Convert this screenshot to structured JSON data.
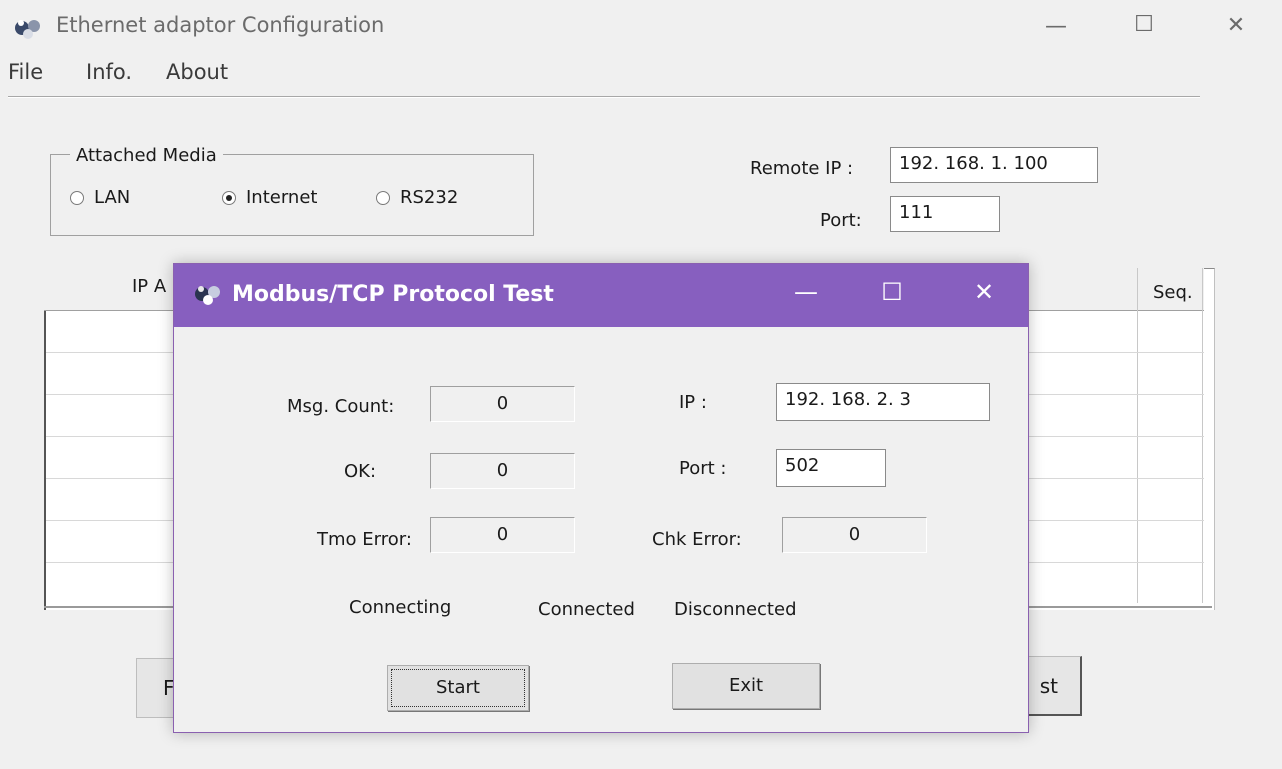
{
  "main_window": {
    "title": "Ethernet adaptor Configuration",
    "controls": {
      "minimize": "—",
      "maximize": "☐",
      "close": "✕"
    },
    "menu": [
      "File",
      "Info.",
      "About"
    ]
  },
  "attached_media": {
    "label": "Attached Media",
    "options": [
      {
        "label": "LAN",
        "selected": false
      },
      {
        "label": "Internet",
        "selected": true
      },
      {
        "label": "RS232",
        "selected": false
      }
    ]
  },
  "remote": {
    "ip_label": "Remote  IP :",
    "ip_value": "192. 168. 1. 100",
    "port_label": "Port:",
    "port_value": "111"
  },
  "table": {
    "header_left_partial": "IP A",
    "header_seq": "Seq."
  },
  "background_buttons": {
    "left_partial": "F",
    "right_partial": "st"
  },
  "dialog": {
    "title": "Modbus/TCP Protocol Test",
    "controls": {
      "minimize": "—",
      "maximize": "☐",
      "close": "✕"
    },
    "msg_count_label": "Msg. Count:",
    "msg_count_value": "0",
    "ok_label": "OK:",
    "ok_value": "0",
    "tmo_error_label": "Tmo Error:",
    "tmo_error_value": "0",
    "ip_label": "IP :",
    "ip_value": "192. 168. 2. 3",
    "port_label": "Port :",
    "port_value": "502",
    "chk_error_label": "Chk Error:",
    "chk_error_value": "0",
    "status": [
      "Connecting",
      "Connected",
      "Disconnected"
    ],
    "start_label": "Start",
    "exit_label": "Exit"
  }
}
